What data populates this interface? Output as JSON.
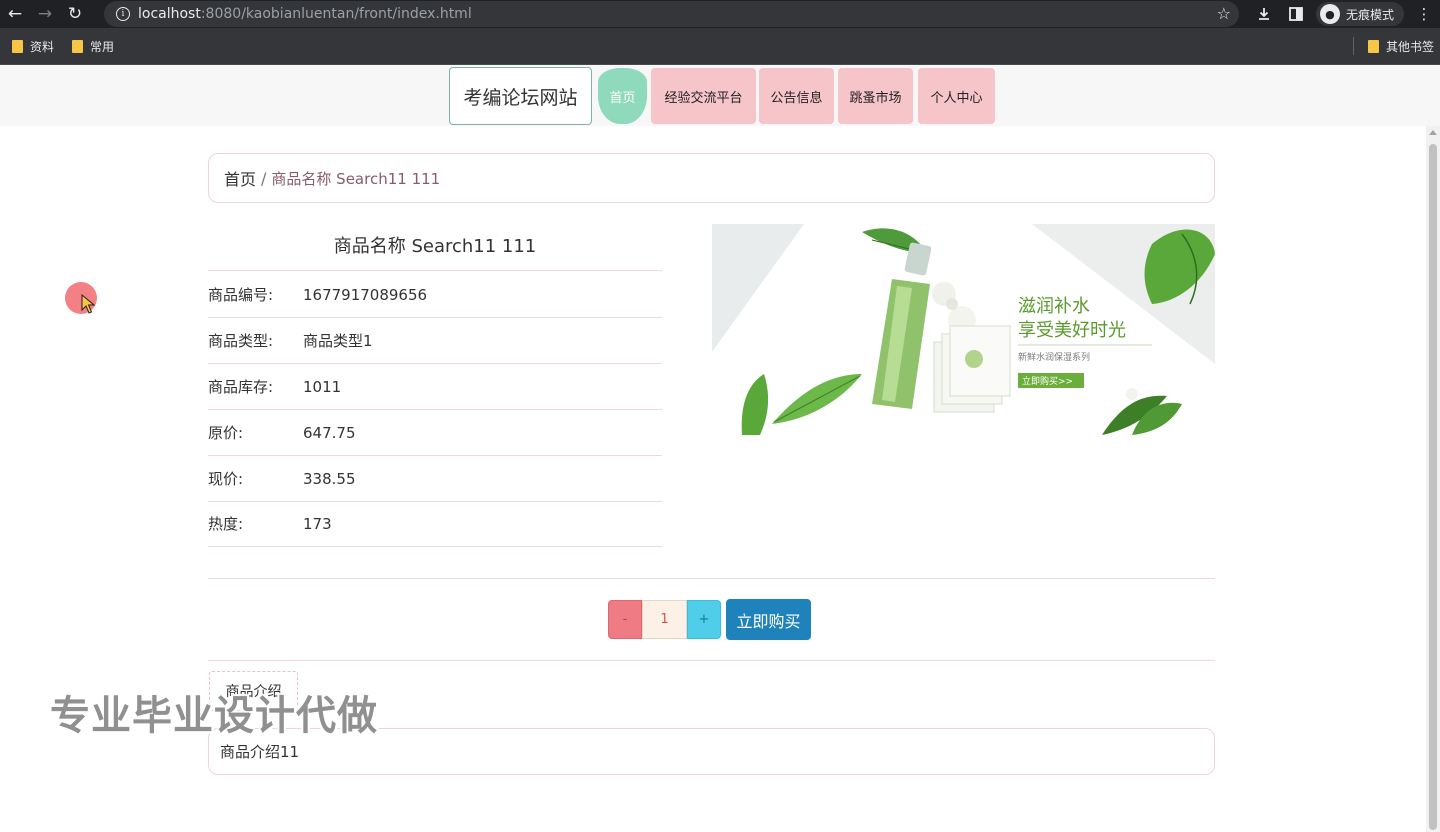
{
  "browser": {
    "url_host": "localhost",
    "url_rest": ":8080/kaobianluentan/front/index.html",
    "incognito_label": "无痕模式",
    "bookmarks": [
      "资料",
      "常用"
    ],
    "other_bookmarks": "其他书签"
  },
  "site": {
    "brand": "考编论坛网站",
    "nav": [
      {
        "label": "首页",
        "active": true
      },
      {
        "label": "经验交流平台",
        "active": false
      },
      {
        "label": "公告信息",
        "active": false
      },
      {
        "label": "跳蚤市场",
        "active": false
      },
      {
        "label": "个人中心",
        "active": false
      }
    ]
  },
  "breadcrumb": {
    "home": "首页",
    "separator": "/",
    "current": "商品名称 Search11 111"
  },
  "goods": {
    "title": "商品名称 Search11 111",
    "details": [
      {
        "label": "商品编号:",
        "value": "1677917089656"
      },
      {
        "label": "商品类型:",
        "value": "商品类型1"
      },
      {
        "label": "商品库存:",
        "value": "1011"
      },
      {
        "label": "原价:",
        "value": "647.75"
      },
      {
        "label": "现价:",
        "value": "338.55"
      },
      {
        "label": "热度:",
        "value": "173"
      }
    ]
  },
  "banner": {
    "line1": "滋润补水",
    "line2": "享受美好时光",
    "line3": "新鲜水润保湿系列",
    "button": "立即购买>>"
  },
  "purchase": {
    "minus": "-",
    "quantity": "1",
    "plus": "+",
    "buy_label": "立即购买"
  },
  "intro": {
    "tab_label": "商品介绍",
    "content": "商品介绍11"
  },
  "watermark": "专业毕业设计代做",
  "colors": {
    "nav_active": "#8fd9bd",
    "nav_item": "#f6c5c9",
    "buy_button": "#1f82ba",
    "minus_button": "#ef7c85",
    "plus_button": "#4fcde9"
  }
}
